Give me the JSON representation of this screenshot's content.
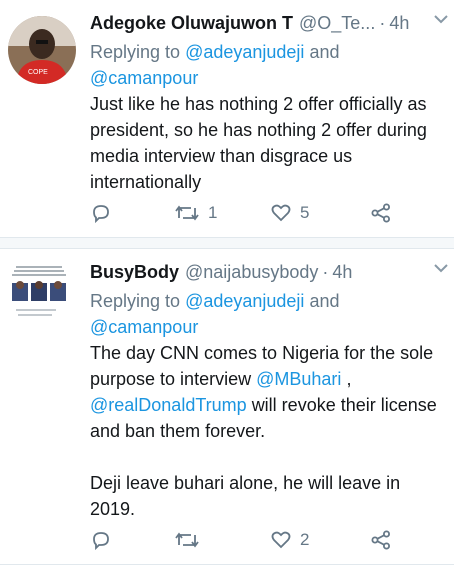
{
  "tweets": [
    {
      "name": "Adegoke Oluwajuwon T",
      "handle": "@O_Te...",
      "dot": "·",
      "time": "4h",
      "replying_prefix": "Replying to",
      "mention_1": "@adeyanjudeji",
      "and": "and",
      "mention_2": "@camanpour",
      "text": "Just like he has nothing 2 offer officially as president, so he has nothing 2 offer during media interview than disgrace us internationally",
      "retweets": "1",
      "likes": "5"
    },
    {
      "name": "BusyBody",
      "handle": "@naijabusybody",
      "dot": "·",
      "time": "4h",
      "replying_prefix": "Replying to",
      "mention_1": "@adeyanjudeji",
      "and": "and",
      "mention_2": "@camanpour",
      "text_1": "The day CNN comes to Nigeria for the sole purpose to interview",
      "text_mention_1": "@MBuhari",
      "text_2": ",",
      "text_mention_2": "@realDonaldTrump",
      "text_3": "will revoke their license and ban them forever.",
      "text_4": "Deji leave buhari alone, he will leave in 2019.",
      "retweets": "",
      "likes": "2"
    }
  ],
  "colors": {
    "link": "#1b95e0",
    "secondary": "#657786",
    "border": "#e1e8ed"
  }
}
